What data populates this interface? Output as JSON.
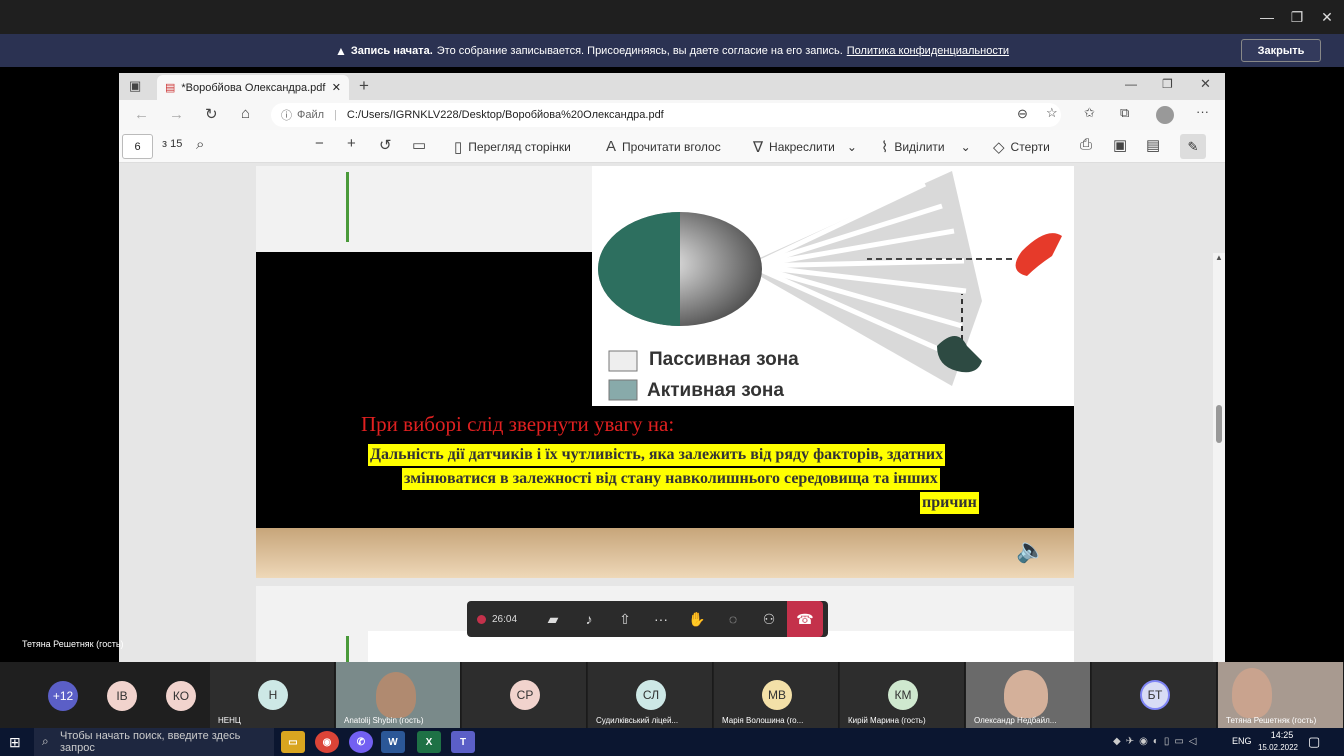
{
  "recording": {
    "title": "Запись начата.",
    "message": "Это собрание записывается. Присоединяясь, вы даете согласие на его запись.",
    "link": "Политика конфиденциальности",
    "close_label": "Закрыть"
  },
  "browser": {
    "tab_title": "*Воробйова Олександра.pdf",
    "url_prefix": "Файл",
    "url": "C:/Users/IGRNKLV228/Desktop/Воробйова%20Олександра.pdf"
  },
  "pdf_toolbar": {
    "page": "6",
    "of_pages": "з 15",
    "page_view": "Перегляд сторінки",
    "read_aloud": "Прочитати вголос",
    "draw": "Накреслити",
    "highlight": "Виділити",
    "erase": "Стерти"
  },
  "slide": {
    "legend_passive": "Пассивная зона",
    "legend_active": "Активная зона",
    "heading": "При виборі слід звернути увагу на:",
    "line1": "Дальність дії датчиків і їх чутливість, яка залежить від ряду факторів, здатних",
    "line2": "змінюватися в залежності від стану навколишнього середовища та інших",
    "line3": "причин"
  },
  "call": {
    "timer": "26:04"
  },
  "presenter_name": "Тетяна Решетняк (гость)",
  "participants": [
    {
      "initials": "+12",
      "name": ""
    },
    {
      "initials": "ІВ",
      "name": ""
    },
    {
      "initials": "КО",
      "name": ""
    },
    {
      "initials": "Н",
      "name": "НЕНЦ"
    },
    {
      "initials": "",
      "name": "Anatolij Shybin (гость)"
    },
    {
      "initials": "СР",
      "name": ""
    },
    {
      "initials": "СЛ",
      "name": "Судилківський ліцей..."
    },
    {
      "initials": "МВ",
      "name": "Марія Волошина (го..."
    },
    {
      "initials": "КМ",
      "name": "Кирій Марина (гость)"
    },
    {
      "initials": "",
      "name": "Олександр Недбайл..."
    },
    {
      "initials": "БТ",
      "name": ""
    },
    {
      "initials": "",
      "name": "Тетяна Решетняк (гость)"
    }
  ],
  "taskbar": {
    "search_placeholder": "Чтобы начать поиск, введите здесь запрос",
    "lang": "ENG",
    "time": "14:25",
    "date": "15.02.2022"
  },
  "colors": {
    "accent_red": "#c4314b",
    "highlight": "#ffff00",
    "heading_red": "#e02020",
    "banner": "#2b3252"
  }
}
